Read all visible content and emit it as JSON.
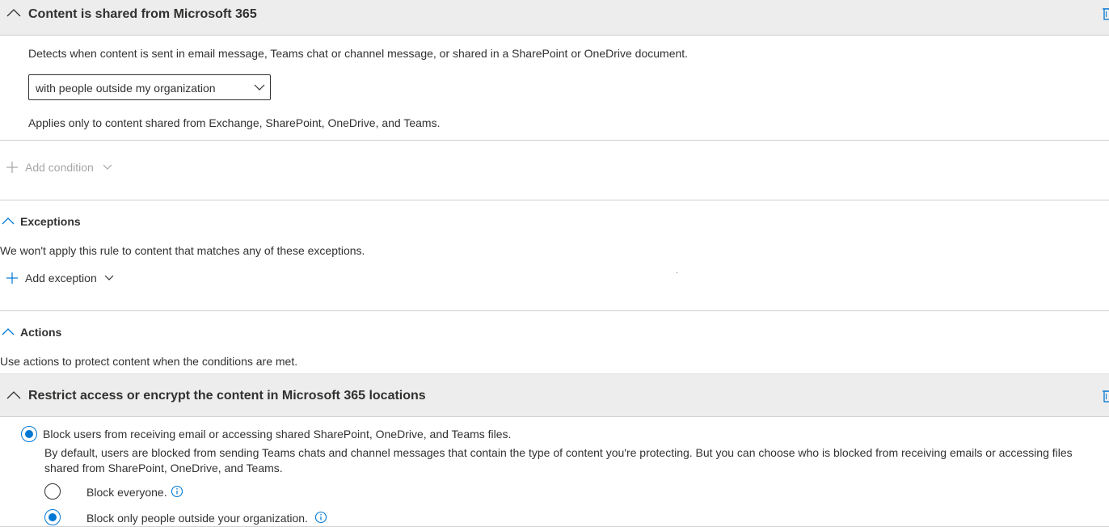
{
  "condition_group": {
    "title": "Content is shared from Microsoft 365",
    "description": "Detects when content is sent in email message, Teams chat or channel message, or shared in a SharePoint or OneDrive document.",
    "dropdown_value": "with people outside my organization",
    "note": "Applies only to content shared from Exchange, SharePoint, OneDrive, and Teams."
  },
  "add_condition_label": "Add condition",
  "exceptions": {
    "title": "Exceptions",
    "description": "We won't apply this rule to content that matches any of these exceptions.",
    "add_label": "Add exception"
  },
  "actions": {
    "title": "Actions",
    "description": "Use actions to protect content when the conditions are met."
  },
  "action_group": {
    "title": "Restrict access or encrypt the content in Microsoft 365 locations",
    "main_option": "Block users from receiving email or accessing shared SharePoint, OneDrive, and Teams files.",
    "main_description": "By default, users are blocked from sending Teams chats and channel messages that contain the type of content you're protecting. But you can choose who is blocked from receiving emails or accessing files shared from SharePoint, OneDrive, and Teams.",
    "options": [
      {
        "label": "Block everyone.",
        "checked": false
      },
      {
        "label": "Block only people outside your organization.",
        "checked": true
      }
    ]
  },
  "colors": {
    "accent": "#0078d4",
    "header_bg": "#ededed",
    "text": "#323130",
    "muted": "#605e5c"
  },
  "icons": [
    "chevron-up-icon",
    "chevron-down-icon",
    "trash-icon",
    "plus-icon",
    "info-icon"
  ]
}
